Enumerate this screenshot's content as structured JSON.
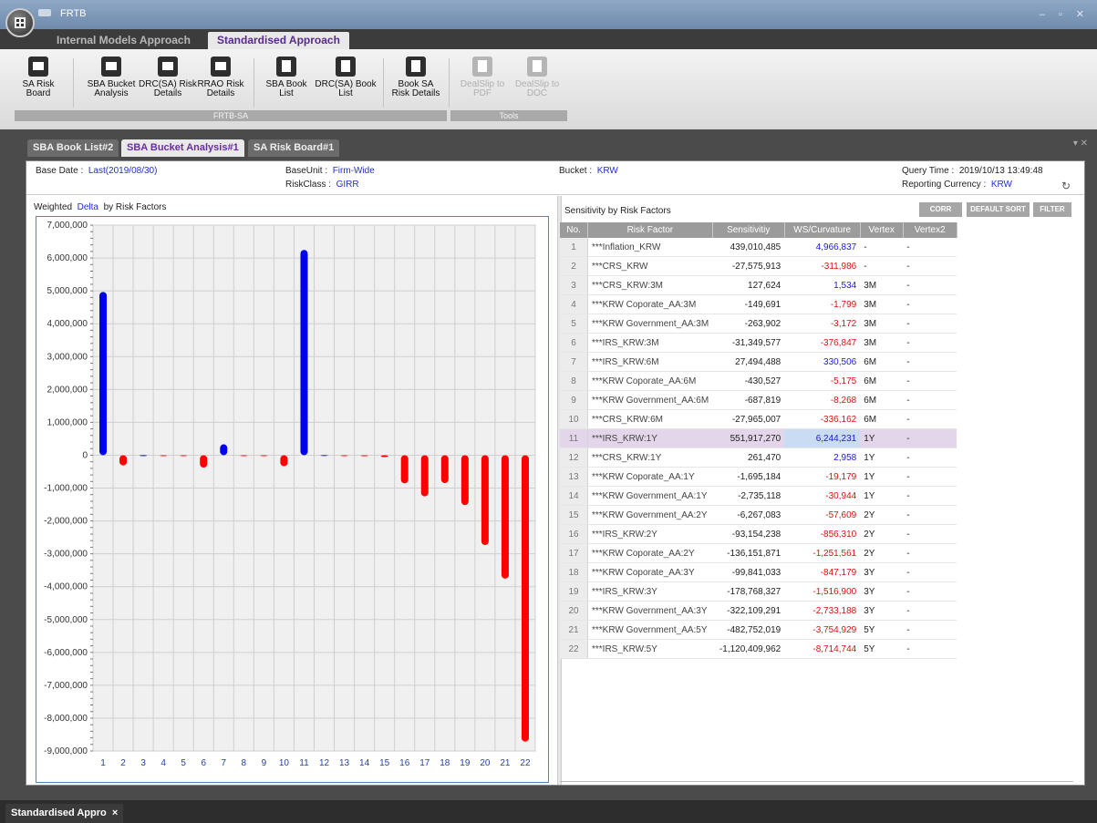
{
  "window": {
    "title": "FRTB"
  },
  "ribbon_tabs": [
    {
      "label": "Internal Models Approach",
      "active": false
    },
    {
      "label": "Standardised Approach",
      "active": true
    }
  ],
  "ribbon_buttons": [
    {
      "label1": "SA Risk",
      "label2": "Board",
      "icon": "folder-icon",
      "enabled": true
    },
    {
      "label1": "SBA Bucket",
      "label2": "Analysis",
      "icon": "folder-icon",
      "enabled": true
    },
    {
      "label1": "DRC(SA) Risk",
      "label2": "Details",
      "icon": "folder-icon",
      "enabled": true
    },
    {
      "label1": "RRAO Risk",
      "label2": "Details",
      "icon": "folder-icon",
      "enabled": true
    },
    {
      "label1": "SBA Book",
      "label2": "List",
      "icon": "document-icon",
      "enabled": true
    },
    {
      "label1": "DRC(SA) Book",
      "label2": "List",
      "icon": "document-icon",
      "enabled": true
    },
    {
      "label1": "Book SA",
      "label2": "Risk Details",
      "icon": "document-icon",
      "enabled": true
    },
    {
      "label1": "DealSlip to",
      "label2": "PDF",
      "icon": "document-icon",
      "enabled": false
    },
    {
      "label1": "DealSlip to",
      "label2": "DOC",
      "icon": "document-icon",
      "enabled": false
    }
  ],
  "ribbon_groups": [
    "FRTB-SA",
    "Tools"
  ],
  "doc_tabs": [
    {
      "label": "SBA Book List#2",
      "active": false
    },
    {
      "label": "SBA Bucket Analysis#1",
      "active": true
    },
    {
      "label": "SA Risk Board#1",
      "active": false
    }
  ],
  "doc_controls": "▾ ✕",
  "info": {
    "base_date_label": "Base Date :",
    "base_date_value": "Last(2019/08/30)",
    "base_unit_label": "BaseUnit :",
    "base_unit_value": "Firm-Wide",
    "risk_class_label": "RiskClass :",
    "risk_class_value": "GIRR",
    "bucket_label": "Bucket :",
    "bucket_value": "KRW",
    "query_time_label": "Query Time :",
    "query_time_value": "2019/10/13 13:49:48",
    "currency_label": "Reporting Currency :",
    "currency_value": "KRW"
  },
  "left_panel": {
    "title_prefix": "Weighted",
    "title_measure": "Delta",
    "title_suffix": "by Risk Factors"
  },
  "right_panel": {
    "title": "Sensitivity by Risk Factors",
    "buttons": [
      "CORR",
      "DEFAULT SORT",
      "FILTER"
    ],
    "columns": [
      "No.",
      "Risk Factor",
      "Sensitivitiy",
      "WS/Curvature",
      "Vertex",
      "Vertex2"
    ],
    "selected_row": 11,
    "rows": [
      {
        "no": "1",
        "rf": "***Inflation_KRW",
        "sens": "439,010,485",
        "ws": "4,966,837",
        "vertex": "-",
        "vertex2": "-"
      },
      {
        "no": "2",
        "rf": "***CRS_KRW",
        "sens": "-27,575,913",
        "ws": "-311,986",
        "vertex": "-",
        "vertex2": "-"
      },
      {
        "no": "3",
        "rf": "***CRS_KRW:3M",
        "sens": "127,624",
        "ws": "1,534",
        "vertex": "3M",
        "vertex2": "-"
      },
      {
        "no": "4",
        "rf": "***KRW Coporate_AA:3M",
        "sens": "-149,691",
        "ws": "-1,799",
        "vertex": "3M",
        "vertex2": "-"
      },
      {
        "no": "5",
        "rf": "***KRW Government_AA:3M",
        "sens": "-263,902",
        "ws": "-3,172",
        "vertex": "3M",
        "vertex2": "-"
      },
      {
        "no": "6",
        "rf": "***IRS_KRW:3M",
        "sens": "-31,349,577",
        "ws": "-376,847",
        "vertex": "3M",
        "vertex2": "-"
      },
      {
        "no": "7",
        "rf": "***IRS_KRW:6M",
        "sens": "27,494,488",
        "ws": "330,506",
        "vertex": "6M",
        "vertex2": "-"
      },
      {
        "no": "8",
        "rf": "***KRW Coporate_AA:6M",
        "sens": "-430,527",
        "ws": "-5,175",
        "vertex": "6M",
        "vertex2": "-"
      },
      {
        "no": "9",
        "rf": "***KRW Government_AA:6M",
        "sens": "-687,819",
        "ws": "-8,268",
        "vertex": "6M",
        "vertex2": "-"
      },
      {
        "no": "10",
        "rf": "***CRS_KRW:6M",
        "sens": "-27,965,007",
        "ws": "-336,162",
        "vertex": "6M",
        "vertex2": "-"
      },
      {
        "no": "11",
        "rf": "***IRS_KRW:1Y",
        "sens": "551,917,270",
        "ws": "6,244,231",
        "vertex": "1Y",
        "vertex2": "-"
      },
      {
        "no": "12",
        "rf": "***CRS_KRW:1Y",
        "sens": "261,470",
        "ws": "2,958",
        "vertex": "1Y",
        "vertex2": "-"
      },
      {
        "no": "13",
        "rf": "***KRW Coporate_AA:1Y",
        "sens": "-1,695,184",
        "ws": "-19,179",
        "vertex": "1Y",
        "vertex2": "-"
      },
      {
        "no": "14",
        "rf": "***KRW Government_AA:1Y",
        "sens": "-2,735,118",
        "ws": "-30,944",
        "vertex": "1Y",
        "vertex2": "-"
      },
      {
        "no": "15",
        "rf": "***KRW Government_AA:2Y",
        "sens": "-6,267,083",
        "ws": "-57,609",
        "vertex": "2Y",
        "vertex2": "-"
      },
      {
        "no": "16",
        "rf": "***IRS_KRW:2Y",
        "sens": "-93,154,238",
        "ws": "-856,310",
        "vertex": "2Y",
        "vertex2": "-"
      },
      {
        "no": "17",
        "rf": "***KRW Coporate_AA:2Y",
        "sens": "-136,151,871",
        "ws": "-1,251,561",
        "vertex": "2Y",
        "vertex2": "-"
      },
      {
        "no": "18",
        "rf": "***KRW Coporate_AA:3Y",
        "sens": "-99,841,033",
        "ws": "-847,179",
        "vertex": "3Y",
        "vertex2": "-"
      },
      {
        "no": "19",
        "rf": "***IRS_KRW:3Y",
        "sens": "-178,768,327",
        "ws": "-1,516,900",
        "vertex": "3Y",
        "vertex2": "-"
      },
      {
        "no": "20",
        "rf": "***KRW Government_AA:3Y",
        "sens": "-322,109,291",
        "ws": "-2,733,188",
        "vertex": "3Y",
        "vertex2": "-"
      },
      {
        "no": "21",
        "rf": "***KRW Government_AA:5Y",
        "sens": "-482,752,019",
        "ws": "-3,754,929",
        "vertex": "5Y",
        "vertex2": "-"
      },
      {
        "no": "22",
        "rf": "***IRS_KRW:5Y",
        "sens": "-1,120,409,962",
        "ws": "-8,714,744",
        "vertex": "5Y",
        "vertex2": "-"
      }
    ]
  },
  "chart_data": {
    "type": "bar",
    "categories": [
      "1",
      "2",
      "3",
      "4",
      "5",
      "6",
      "7",
      "8",
      "9",
      "10",
      "11",
      "12",
      "13",
      "14",
      "15",
      "16",
      "17",
      "18",
      "19",
      "20",
      "21",
      "22"
    ],
    "values": [
      4966837,
      -311986,
      1534,
      -1799,
      -3172,
      -376847,
      330506,
      -5175,
      -8268,
      -336162,
      6244231,
      2958,
      -19179,
      -30944,
      -57609,
      -856310,
      -1251561,
      -847179,
      -1516900,
      -2733188,
      -3754929,
      -8714744
    ],
    "ylim": [
      -9000000,
      7000000
    ],
    "yticks": [
      "7,000,000",
      "6,000,000",
      "5,000,000",
      "4,000,000",
      "3,000,000",
      "2,000,000",
      "1,000,000",
      "0",
      "-1,000,000",
      "-2,000,000",
      "-3,000,000",
      "-4,000,000",
      "-5,000,000",
      "-6,000,000",
      "-7,000,000",
      "-8,000,000",
      "-9,000,000"
    ],
    "ytick_values": [
      7000000,
      6000000,
      5000000,
      4000000,
      3000000,
      2000000,
      1000000,
      0,
      -1000000,
      -2000000,
      -3000000,
      -4000000,
      -5000000,
      -6000000,
      -7000000,
      -8000000,
      -9000000
    ],
    "grid": true,
    "colors": {
      "positive": "#0000ee",
      "negative": "#ff0000",
      "plot_bg": "#f0f0f0"
    }
  },
  "colors": {
    "positive_text": "#1a1adf",
    "negative_text": "#e01010",
    "accent": "#6a2ca0"
  },
  "status_tab": {
    "label": "Standardised Appro",
    "close": "×"
  }
}
